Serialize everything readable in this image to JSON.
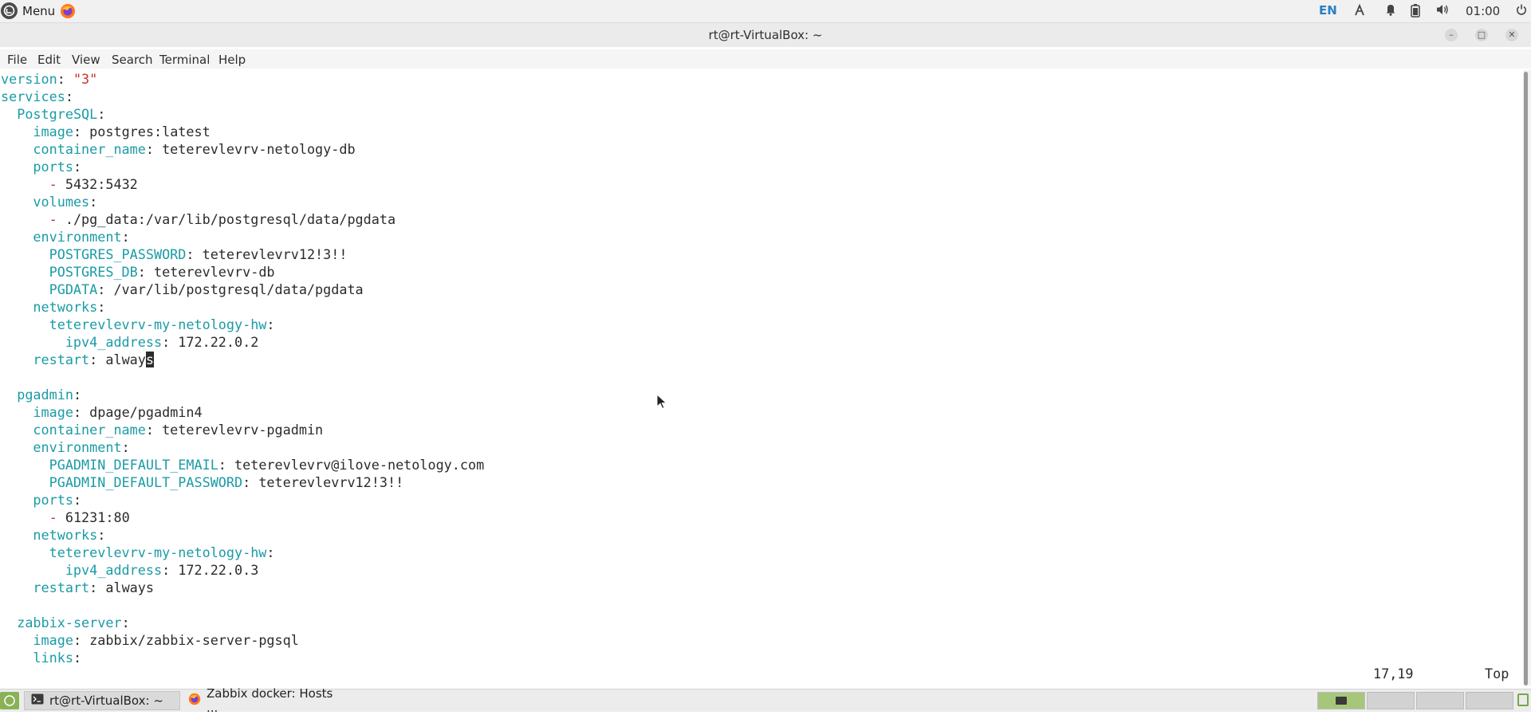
{
  "top_panel": {
    "menu_label": "Menu",
    "lang": "EN",
    "clock": "01:00",
    "icons": [
      "linux-mint-logo-icon",
      "firefox-icon",
      "network-icon",
      "bell-icon",
      "battery-icon",
      "volume-icon",
      "power-icon"
    ]
  },
  "window": {
    "title": "rt@rt-VirtualBox: ~",
    "buttons": {
      "minimize": "–",
      "maximize": "□",
      "close": "✕"
    }
  },
  "menubar": [
    "File",
    "Edit",
    "View",
    "Search",
    "Terminal",
    "Help"
  ],
  "terminal": {
    "lines": [
      [
        {
          "t": "key",
          "s": "version"
        },
        {
          "t": "val",
          "s": ": "
        },
        {
          "t": "str",
          "s": "\"3\""
        }
      ],
      [
        {
          "t": "key",
          "s": "services"
        },
        {
          "t": "val",
          "s": ":"
        }
      ],
      [
        {
          "t": "val",
          "s": "  "
        },
        {
          "t": "key",
          "s": "PostgreSQL"
        },
        {
          "t": "val",
          "s": ":"
        }
      ],
      [
        {
          "t": "val",
          "s": "    "
        },
        {
          "t": "key",
          "s": "image"
        },
        {
          "t": "val",
          "s": ": postgres:latest"
        }
      ],
      [
        {
          "t": "val",
          "s": "    "
        },
        {
          "t": "key",
          "s": "container_name"
        },
        {
          "t": "val",
          "s": ": teterevlevrv-netology-db"
        }
      ],
      [
        {
          "t": "val",
          "s": "    "
        },
        {
          "t": "key",
          "s": "ports"
        },
        {
          "t": "val",
          "s": ":"
        }
      ],
      [
        {
          "t": "val",
          "s": "      "
        },
        {
          "t": "str",
          "s": "- "
        },
        {
          "t": "val",
          "s": "5432:5432"
        }
      ],
      [
        {
          "t": "val",
          "s": "    "
        },
        {
          "t": "key",
          "s": "volumes"
        },
        {
          "t": "val",
          "s": ":"
        }
      ],
      [
        {
          "t": "val",
          "s": "      "
        },
        {
          "t": "str",
          "s": "- "
        },
        {
          "t": "val",
          "s": "./pg_data:/var/lib/postgresql/data/pgdata"
        }
      ],
      [
        {
          "t": "val",
          "s": "    "
        },
        {
          "t": "key",
          "s": "environment"
        },
        {
          "t": "val",
          "s": ":"
        }
      ],
      [
        {
          "t": "val",
          "s": "      "
        },
        {
          "t": "key",
          "s": "POSTGRES_PASSWORD"
        },
        {
          "t": "val",
          "s": ": teterevlevrv12!3!!"
        }
      ],
      [
        {
          "t": "val",
          "s": "      "
        },
        {
          "t": "key",
          "s": "POSTGRES_DB"
        },
        {
          "t": "val",
          "s": ": teterevlevrv-db"
        }
      ],
      [
        {
          "t": "val",
          "s": "      "
        },
        {
          "t": "key",
          "s": "PGDATA"
        },
        {
          "t": "val",
          "s": ": /var/lib/postgresql/data/pgdata"
        }
      ],
      [
        {
          "t": "val",
          "s": "    "
        },
        {
          "t": "key",
          "s": "networks"
        },
        {
          "t": "val",
          "s": ":"
        }
      ],
      [
        {
          "t": "val",
          "s": "      "
        },
        {
          "t": "key",
          "s": "teterevlevrv-my-netology-hw"
        },
        {
          "t": "val",
          "s": ":"
        }
      ],
      [
        {
          "t": "val",
          "s": "        "
        },
        {
          "t": "key",
          "s": "ipv4_address"
        },
        {
          "t": "val",
          "s": ": 172.22.0.2"
        }
      ],
      [
        {
          "t": "val",
          "s": "    "
        },
        {
          "t": "key",
          "s": "restart"
        },
        {
          "t": "val",
          "s": ": always"
        }
      ],
      [],
      [
        {
          "t": "val",
          "s": "  "
        },
        {
          "t": "key",
          "s": "pgadmin"
        },
        {
          "t": "val",
          "s": ":"
        }
      ],
      [
        {
          "t": "val",
          "s": "    "
        },
        {
          "t": "key",
          "s": "image"
        },
        {
          "t": "val",
          "s": ": dpage/pgadmin4"
        }
      ],
      [
        {
          "t": "val",
          "s": "    "
        },
        {
          "t": "key",
          "s": "container_name"
        },
        {
          "t": "val",
          "s": ": teterevlevrv-pgadmin"
        }
      ],
      [
        {
          "t": "val",
          "s": "    "
        },
        {
          "t": "key",
          "s": "environment"
        },
        {
          "t": "val",
          "s": ":"
        }
      ],
      [
        {
          "t": "val",
          "s": "      "
        },
        {
          "t": "key",
          "s": "PGADMIN_DEFAULT_EMAIL"
        },
        {
          "t": "val",
          "s": ": teterevlevrv@ilove-netology.com"
        }
      ],
      [
        {
          "t": "val",
          "s": "      "
        },
        {
          "t": "key",
          "s": "PGADMIN_DEFAULT_PASSWORD"
        },
        {
          "t": "val",
          "s": ": teterevlevrv12!3!!"
        }
      ],
      [
        {
          "t": "val",
          "s": "    "
        },
        {
          "t": "key",
          "s": "ports"
        },
        {
          "t": "val",
          "s": ":"
        }
      ],
      [
        {
          "t": "val",
          "s": "      "
        },
        {
          "t": "str",
          "s": "- "
        },
        {
          "t": "val",
          "s": "61231:80"
        }
      ],
      [
        {
          "t": "val",
          "s": "    "
        },
        {
          "t": "key",
          "s": "networks"
        },
        {
          "t": "val",
          "s": ":"
        }
      ],
      [
        {
          "t": "val",
          "s": "      "
        },
        {
          "t": "key",
          "s": "teterevlevrv-my-netology-hw"
        },
        {
          "t": "val",
          "s": ":"
        }
      ],
      [
        {
          "t": "val",
          "s": "        "
        },
        {
          "t": "key",
          "s": "ipv4_address"
        },
        {
          "t": "val",
          "s": ": 172.22.0.3"
        }
      ],
      [
        {
          "t": "val",
          "s": "    "
        },
        {
          "t": "key",
          "s": "restart"
        },
        {
          "t": "val",
          "s": ": always"
        }
      ],
      [],
      [
        {
          "t": "val",
          "s": "  "
        },
        {
          "t": "key",
          "s": "zabbix-server"
        },
        {
          "t": "val",
          "s": ":"
        }
      ],
      [
        {
          "t": "val",
          "s": "    "
        },
        {
          "t": "key",
          "s": "image"
        },
        {
          "t": "val",
          "s": ": zabbix/zabbix-server-pgsql"
        }
      ],
      [
        {
          "t": "val",
          "s": "    "
        },
        {
          "t": "key",
          "s": "links"
        },
        {
          "t": "val",
          "s": ":"
        }
      ]
    ],
    "cursor_line": 17,
    "cursor_col": 19,
    "status_position": "17,19",
    "status_scroll": "Top"
  },
  "taskbar": {
    "tasks": [
      {
        "label": "rt@rt-VirtualBox: ~",
        "icon": "terminal-icon",
        "active": true
      },
      {
        "label": "Zabbix docker: Hosts ...",
        "icon": "firefox-icon",
        "active": false
      }
    ],
    "workspace_count": 4,
    "active_workspace": 1
  }
}
